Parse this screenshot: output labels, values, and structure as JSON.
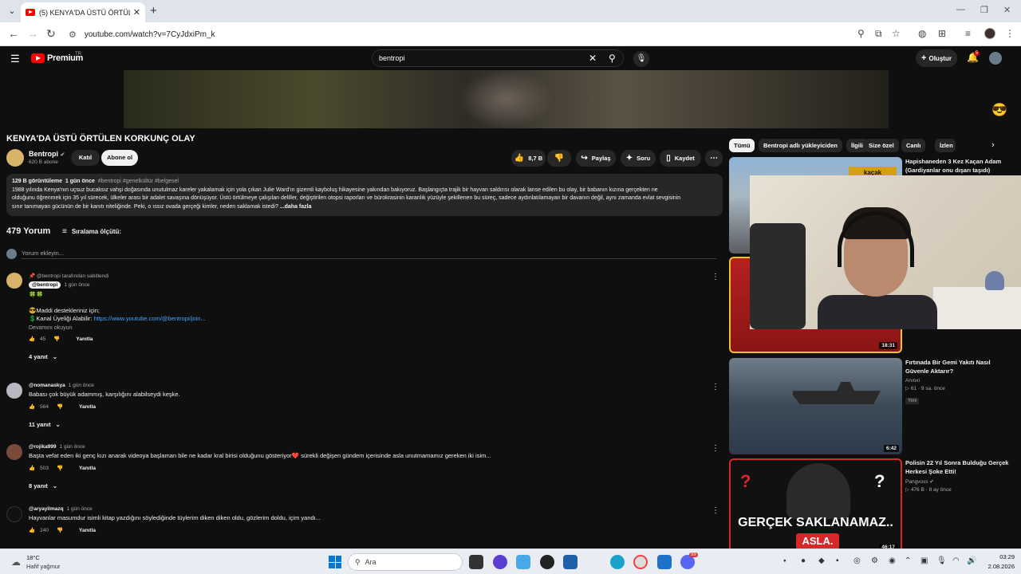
{
  "browser": {
    "tab_title": "(5) KENYA'DA ÜSTÜ ÖRTÜLEN K",
    "url": "youtube.com/watch?v=7CyJdxiPm_k"
  },
  "yt": {
    "brand": "Premium",
    "country": "TR",
    "search_value": "bentropi",
    "create_label": "Oluştur",
    "notifications": "5"
  },
  "video": {
    "title": "KENYA'DA ÜSTÜ ÖRTÜLEN KORKUNÇ OLAY",
    "channel": "Bentropi",
    "subscribers": "620 B abone",
    "join_label": "Katıl",
    "subscribed_label": "Abone ol",
    "likes": "8,7 B",
    "share_label": "Paylaş",
    "ask_label": "Soru",
    "save_label": "Kaydet"
  },
  "description": {
    "views": "129 B görüntüleme",
    "age": "1 gün önce",
    "tags": "#bentropi #genelkültür #belgesel",
    "line1": "1988 yılında Kenya'nın uçsuz bucaksız vahşi doğasında unutulmaz kareler yakalamak için yola çıkan Julie Ward'ın gizemli kayboluş hikayesine yakından bakıyoruz. Başlangıçta trajik bir hayvan saldırısı olarak lanse edilen bu olay, bir babanın kızına gerçekten ne",
    "line2": "olduğunu öğrenmek için 35 yıl sürecek, ülkeler arası bir adalet savaşına dönüşüyor. Üstü örtülmeye çalışılan deliller, değiştirilen otopsi raporları ve bürokrasinin karanlık yüzüyle şekillenen bu süreç, sadece aydınlatılamayan bir davanın değil, aynı zamanda evlat sevgisinin",
    "line3": "sınır tanımayan gücünün de bir kanıtı niteliğinde. Peki, o ıssız ovada gerçeği kimler, neden saklamak istedi?",
    "more": "...daha fazla"
  },
  "comments": {
    "count": "479 Yorum",
    "sort_label": "Sıralama ölçütü:",
    "add_placeholder": "Yorum ekleyin...",
    "items": [
      {
        "pinned": "@bentropi tarafından sabitlendi",
        "author": "@bentropi",
        "time": "1 gün önce",
        "emoji_line": "🍀🍀",
        "line1": "😎Maddi destekleriniz için;",
        "line2_prefix": "💲Kanal Üyeliği Alabilir:",
        "line2_link": "https://www.youtube.com/@bentropi/join...",
        "readmore": "Devamını okuyun",
        "likes": "45",
        "reply": "Yanıtla",
        "replies": "4 yanıt"
      },
      {
        "author": "@nomanaskya",
        "time": "1 gün önce",
        "text": "Babası çok büyük adammış, karşılığını alabilseydi keşke.",
        "likes": "564",
        "reply": "Yanıtla",
        "replies": "11 yanıt"
      },
      {
        "author": "@rojika999",
        "time": "1 gün önce",
        "text": "Başta vefat eden iki genç kızı anarak videoya başlaman bile ne kadar kral birisi olduğunu gösteriyor❤️ sürekli değişen gündem içerisinde asla unutmamamız gereken iki isim...",
        "likes": "503",
        "reply": "Yanıtla",
        "replies": "8 yanıt"
      },
      {
        "author": "@aryayilmazq",
        "time": "1 gün önce",
        "text": "Hayvanlar masumdur isimli kitap yazdığını söylediğinde tüylerim diken diken oldu, gözlerim doldu, içim yandı...",
        "likes": "240",
        "reply": "Yanıtla"
      }
    ]
  },
  "sidebar": {
    "chips": [
      "Tümü",
      "Bentropi adlı yükleyiciden",
      "İlgili",
      "Size özel",
      "Canlı",
      "İzlen"
    ],
    "videos": [
      {
        "title": "Hapishaneden 3 Kez Kaçan Adam (Gardiyanlar onu dışarı taşıdı)",
        "sign": "kaçak",
        "duration": "18:31"
      },
      {
        "title": "Fırtınada Bir Gemi Yakıtı Nasıl Güvenle Aktarır?",
        "channel": "Arvoxi",
        "meta": "61 · 9 sa. önce",
        "badge": "Yeni",
        "duration": "6:42"
      },
      {
        "title": "Polisin 22 Yıl Sonra Bulduğu Gerçek Herkesi Şoke Etti!",
        "channel": "Pangvoss",
        "meta": "476 B · 8 ay önce",
        "thumb_text1": "GERÇEK SAKLANAMAZ..",
        "thumb_text2": "ASLA.",
        "duration": "46:17"
      }
    ]
  },
  "taskbar": {
    "temp": "18°C",
    "weather": "Hafif yağmur",
    "search_placeholder": "Ara",
    "time": "03:29",
    "date": "2.08.2026",
    "teams_badge": "99"
  }
}
